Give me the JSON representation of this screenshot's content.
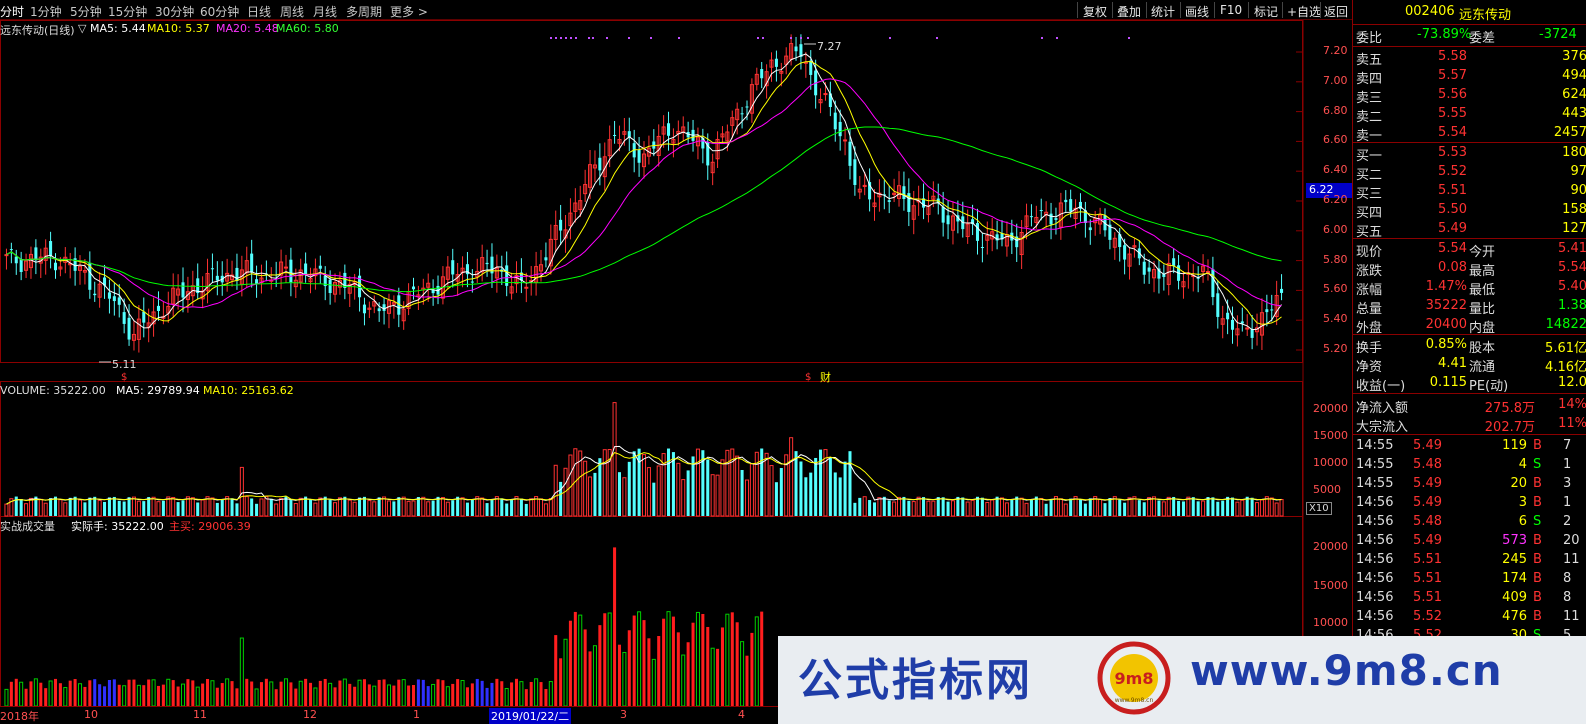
{
  "topbar": {
    "tabs": [
      "分时",
      "1分钟",
      "5分钟",
      "15分钟",
      "30分钟",
      "60分钟",
      "日线",
      "周线",
      "月线",
      "多周期",
      "更多 >"
    ],
    "buttons": [
      "复权",
      "叠加",
      "统计",
      "画线",
      "F10",
      "标记",
      "+自选",
      "返回"
    ]
  },
  "price_panel": {
    "title": "远东传动(日线)",
    "ma_indicator": "▽",
    "ma5": "MA5: 5.44",
    "ma10": "MA10: 5.37",
    "ma20": "MA20: 5.48",
    "ma60": "MA60: 5.80",
    "high_marker": "7.27",
    "low_marker": "5.11",
    "cursor_price": "6.22",
    "fin_marker": "财",
    "y_ticks": [
      "7.20",
      "7.00",
      "6.80",
      "6.60",
      "6.40",
      "6.20",
      "6.00",
      "5.80",
      "5.60",
      "5.40",
      "5.20"
    ]
  },
  "volume_panel": {
    "title": "VOLUME: 35222.00",
    "ma5": "MA5: 29789.94",
    "ma10": "MA10: 25163.62",
    "y_ticks": [
      "20000",
      "15000",
      "10000",
      "5000"
    ],
    "unit": "X10"
  },
  "real_volume_panel": {
    "title": "实战成交量",
    "actual": "实际手: 35222.00",
    "main_buy": "主买: 29006.39",
    "y_ticks": [
      "20000",
      "15000",
      "10000"
    ]
  },
  "x_axis": {
    "labels": [
      "2018年",
      "10",
      "11",
      "12",
      "1",
      "2019/01/22/二",
      "3",
      "4"
    ]
  },
  "quote": {
    "code": "002406",
    "name": "远东传动",
    "wei_bi_label": "委比",
    "wei_bi": "-73.89%",
    "wei_cha_label": "委差",
    "wei_cha": "-3724",
    "asks": [
      {
        "label": "卖五",
        "price": "5.58",
        "vol": "376"
      },
      {
        "label": "卖四",
        "price": "5.57",
        "vol": "494"
      },
      {
        "label": "卖三",
        "price": "5.56",
        "vol": "624"
      },
      {
        "label": "卖二",
        "price": "5.55",
        "vol": "443"
      },
      {
        "label": "卖一",
        "price": "5.54",
        "vol": "2457"
      }
    ],
    "bids": [
      {
        "label": "买一",
        "price": "5.53",
        "vol": "180"
      },
      {
        "label": "买二",
        "price": "5.52",
        "vol": "97"
      },
      {
        "label": "买三",
        "price": "5.51",
        "vol": "90"
      },
      {
        "label": "买四",
        "price": "5.50",
        "vol": "158"
      },
      {
        "label": "买五",
        "price": "5.49",
        "vol": "127"
      }
    ],
    "stats": [
      {
        "l1": "现价",
        "v1": "5.54",
        "l2": "今开",
        "v2": "5.41"
      },
      {
        "l1": "涨跌",
        "v1": "0.08",
        "l2": "最高",
        "v2": "5.54"
      },
      {
        "l1": "涨幅",
        "v1": "1.47%",
        "l2": "最低",
        "v2": "5.40"
      },
      {
        "l1": "总量",
        "v1": "35222",
        "l2": "量比",
        "v2": "1.38"
      },
      {
        "l1": "外盘",
        "v1": "20400",
        "l2": "内盘",
        "v2": "14822"
      }
    ],
    "stats2": [
      {
        "l1": "换手",
        "v1": "0.85%",
        "l2": "股本",
        "v2": "5.61亿"
      },
      {
        "l1": "净资",
        "v1": "4.41",
        "l2": "流通",
        "v2": "4.16亿"
      },
      {
        "l1": "收益(一)",
        "v1": "0.115",
        "l2": "PE(动)",
        "v2": "12.0"
      }
    ],
    "flows": [
      {
        "label": "净流入额",
        "value": "275.8万",
        "pct": "14%"
      },
      {
        "label": "大宗流入",
        "value": "202.7万",
        "pct": "11%"
      }
    ],
    "ticks": [
      {
        "time": "14:55",
        "price": "5.49",
        "vol": "119",
        "side": "B",
        "extra": "7"
      },
      {
        "time": "14:55",
        "price": "5.48",
        "vol": "4",
        "side": "S",
        "extra": "1"
      },
      {
        "time": "14:55",
        "price": "5.49",
        "vol": "20",
        "side": "B",
        "extra": "3"
      },
      {
        "time": "14:56",
        "price": "5.49",
        "vol": "3",
        "side": "B",
        "extra": "1"
      },
      {
        "time": "14:56",
        "price": "5.48",
        "vol": "6",
        "side": "S",
        "extra": "2"
      },
      {
        "time": "14:56",
        "price": "5.49",
        "vol": "573",
        "side": "B",
        "extra": "20"
      },
      {
        "time": "14:56",
        "price": "5.51",
        "vol": "245",
        "side": "B",
        "extra": "11"
      },
      {
        "time": "14:56",
        "price": "5.51",
        "vol": "174",
        "side": "B",
        "extra": "8"
      },
      {
        "time": "14:56",
        "price": "5.51",
        "vol": "409",
        "side": "B",
        "extra": "8"
      },
      {
        "time": "14:56",
        "price": "5.52",
        "vol": "476",
        "side": "B",
        "extra": "11"
      },
      {
        "time": "14:56",
        "price": "5.52",
        "vol": "30",
        "side": "S",
        "extra": "5"
      }
    ]
  },
  "banner": {
    "text1": "公式指标网",
    "text2": "www.9m8.cn",
    "logo_text": "9m8",
    "logo_sub": "www.9m8.cn"
  },
  "colors": {
    "up": "#ff3232",
    "down": "#54ffff",
    "ma5": "#ffffff",
    "ma10": "#ffff00",
    "ma20": "#ff00ff",
    "ma60": "#00ff00",
    "grid": "#8b0000"
  }
}
